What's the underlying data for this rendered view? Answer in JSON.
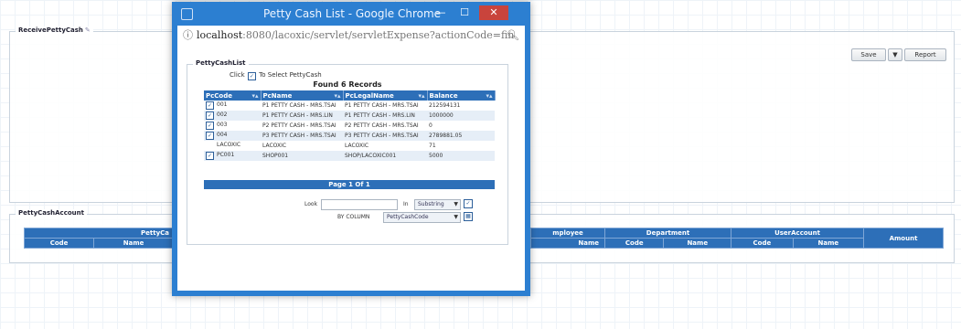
{
  "receive": {
    "legend": "ReceivePettyCash",
    "edit_icon": "pencil-icon",
    "save_label": "Save",
    "report_label": "Report"
  },
  "account": {
    "legend": "PettyCashAccount",
    "group_headers": [
      "PettyCa",
      "mployee",
      "Department",
      "UserAccount",
      "Amount"
    ],
    "sub_headers": [
      "Code",
      "Name",
      "Name",
      "Code",
      "Name",
      "Code",
      "Name"
    ]
  },
  "popup": {
    "title": "Petty Cash List - Google Chrome",
    "url_host": "localhost",
    "url_path": ":8080/lacoxic/servlet/servletExpense?actionCode=fin",
    "legend": "PettyCashList",
    "instruction_pre": "Click",
    "instruction_post": "To Select PettyCash",
    "found_text": "Found 6 Records",
    "columns": [
      "PcCode",
      "PcName",
      "PcLegalName",
      "Balance"
    ],
    "rows": [
      {
        "code": "001",
        "name": "P1 PETTY CASH - MRS.TSAI",
        "legal": "P1 PETTY CASH - MRS.TSAI",
        "balance": "212594131"
      },
      {
        "code": "002",
        "name": "P1 PETTY CASH - MRS.LIN",
        "legal": "P1 PETTY CASH - MRS.LIN",
        "balance": "1000000"
      },
      {
        "code": "003",
        "name": "P2 PETTY CASH - MRS.TSAI",
        "legal": "P2 PETTY CASH - MRS.TSAI",
        "balance": "0"
      },
      {
        "code": "004",
        "name": "P3 PETTY CASH - MRS.TSAI",
        "legal": "P3 PETTY CASH - MRS.TSAI",
        "balance": "2789881.05"
      },
      {
        "code": "LACOXIC",
        "name": "LACOXIC",
        "legal": "LACOXIC",
        "balance": "71"
      },
      {
        "code": "PC001",
        "name": "SHOP001",
        "legal": "SHOP/LACOXIC001",
        "balance": "5000"
      }
    ],
    "pager": "Page 1 Of 1",
    "search_label": "Look",
    "in_label": "In",
    "in_option": "Substring",
    "by_label": "BY COLUMN",
    "by_option": "PettyCashCode"
  }
}
